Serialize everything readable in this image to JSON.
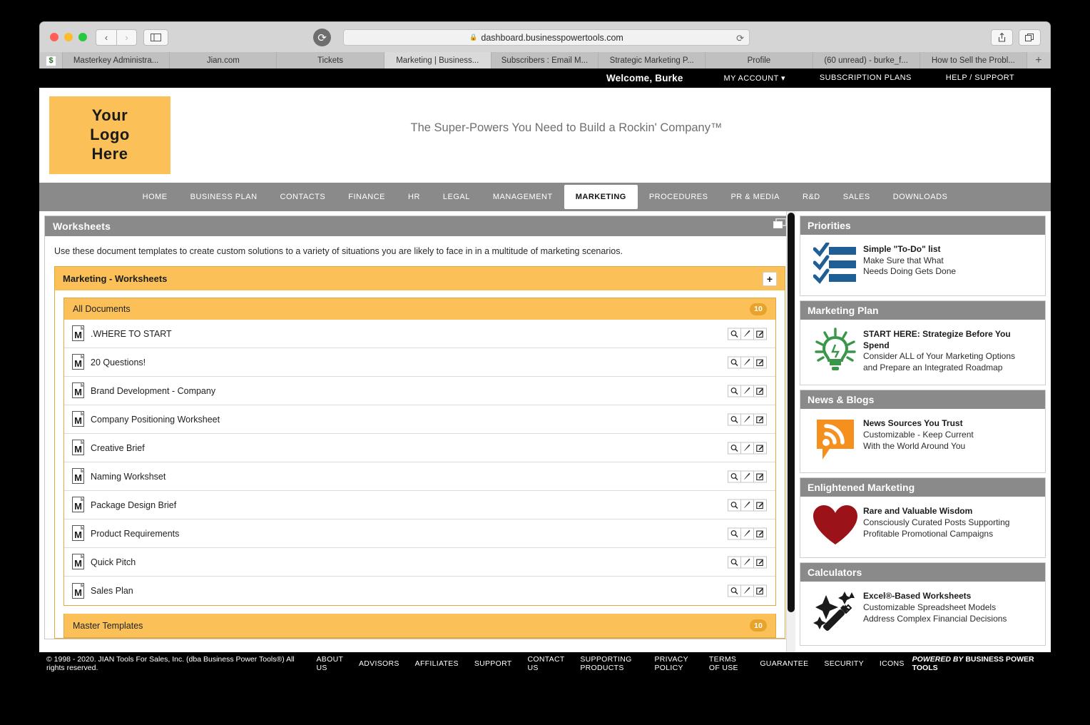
{
  "browser": {
    "url": "dashboard.businesspowertools.com",
    "lock_icon": "lock-icon",
    "back_label": "‹",
    "forward_label": "›",
    "sidebar_icon": "sidebar-icon",
    "reload_icon": "reload-icon",
    "share_icon": "share-icon",
    "tabs_overview_icon": "tabs-overview-icon",
    "new_tab_label": "+",
    "favicon_label": "$",
    "tabs": [
      {
        "label": "Masterkey Administra...",
        "active": false
      },
      {
        "label": "Jian.com",
        "active": false
      },
      {
        "label": "Tickets",
        "active": false
      },
      {
        "label": "Marketing | Business...",
        "active": true
      },
      {
        "label": "Subscribers : Email M...",
        "active": false
      },
      {
        "label": "Strategic Marketing P...",
        "active": false
      },
      {
        "label": "Profile",
        "active": false
      },
      {
        "label": "(60 unread) - burke_f...",
        "active": false
      },
      {
        "label": "How to Sell the Probl...",
        "active": false
      }
    ]
  },
  "topbar": {
    "welcome": "Welcome, Burke",
    "menu": [
      {
        "label": "MY ACCOUNT ▾"
      },
      {
        "label": "SUBSCRIPTION PLANS"
      },
      {
        "label": "HELP / SUPPORT"
      }
    ]
  },
  "header": {
    "logo_lines": [
      "Your",
      "Logo",
      "Here"
    ],
    "tagline": "The Super-Powers You Need to Build a Rockin' Company™"
  },
  "mainnav": [
    {
      "label": "HOME",
      "active": false
    },
    {
      "label": "BUSINESS PLAN",
      "active": false
    },
    {
      "label": "CONTACTS",
      "active": false
    },
    {
      "label": "FINANCE",
      "active": false
    },
    {
      "label": "HR",
      "active": false
    },
    {
      "label": "LEGAL",
      "active": false
    },
    {
      "label": "MANAGEMENT",
      "active": false
    },
    {
      "label": "MARKETING",
      "active": true
    },
    {
      "label": "PROCEDURES",
      "active": false
    },
    {
      "label": "PR & MEDIA",
      "active": false
    },
    {
      "label": "R&D",
      "active": false
    },
    {
      "label": "SALES",
      "active": false
    },
    {
      "label": "DOWNLOADS",
      "active": false
    }
  ],
  "worksheets": {
    "panel_title": "Worksheets",
    "panel_icon": "restore-window-icon",
    "intro": "Use these document templates to create custom solutions to a variety of situations you are likely to face in in a multitude of marketing scenarios.",
    "group_title": "Marketing - Worksheets",
    "add_label": "+",
    "all_documents_label": "All Documents",
    "all_documents_count": "10",
    "master_templates_label": "Master Templates",
    "master_templates_count": "10",
    "row_actions": [
      {
        "icon": "magnifier-icon",
        "name": "preview-button"
      },
      {
        "icon": "pencil-icon",
        "name": "edit-button"
      },
      {
        "icon": "edit-square-icon",
        "name": "edit-online-button"
      }
    ],
    "documents": [
      {
        "name": ".WHERE TO START",
        "icon": "word-doc-icon"
      },
      {
        "name": "20 Questions!",
        "icon": "word-doc-icon"
      },
      {
        "name": "Brand Development - Company",
        "icon": "word-doc-icon"
      },
      {
        "name": "Company Positioning Worksheet",
        "icon": "word-doc-icon"
      },
      {
        "name": "Creative Brief",
        "icon": "word-doc-icon"
      },
      {
        "name": "Naming Workshset",
        "icon": "word-doc-icon"
      },
      {
        "name": "Package Design Brief",
        "icon": "word-doc-icon"
      },
      {
        "name": "Product Requirements",
        "icon": "word-doc-icon"
      },
      {
        "name": "Quick Pitch",
        "icon": "word-doc-icon"
      },
      {
        "name": "Sales Plan",
        "icon": "word-doc-icon"
      }
    ]
  },
  "sidebar_cards": [
    {
      "title": "Priorities",
      "icon": "checklist-icon",
      "line1": "Simple \"To-Do\" list",
      "line2": "Make Sure that What",
      "line3": "Needs Doing Gets Done"
    },
    {
      "title": "Marketing Plan",
      "icon": "lightbulb-icon",
      "line1": "START HERE: Strategize Before You Spend",
      "line2": "Consider ALL of Your Marketing Options",
      "line3": "and Prepare an Integrated Roadmap"
    },
    {
      "title": "News & Blogs",
      "icon": "rss-icon",
      "line1": "News Sources You Trust",
      "line2": "Customizable - Keep Current",
      "line3": "With the World Around You"
    },
    {
      "title": "Enlightened Marketing",
      "icon": "heart-icon",
      "line1": "Rare and Valuable Wisdom",
      "line2": "Consciously Curated Posts Supporting",
      "line3": "Profitable Promotional Campaigns"
    },
    {
      "title": "Calculators",
      "icon": "magic-wand-icon",
      "line1": "Excel®-Based Worksheets",
      "line2": "Customizable Spreadsheet Models",
      "line3": "Address Complex Financial Decisions"
    }
  ],
  "footer": {
    "copyright": "© 1998 - 2020. JIAN Tools For Sales, Inc. (dba Business Power Tools®) All rights reserved.",
    "links": [
      "ABOUT US",
      "ADVISORS",
      "AFFILIATES",
      "SUPPORT",
      "CONTACT US",
      "SUPPORTING PRODUCTS",
      "PRIVACY POLICY",
      "TERMS OF USE",
      "GUARANTEE",
      "SECURITY",
      "ICONS"
    ],
    "powered_italic": "POWERED BY",
    "powered_rest": " BUSINESS POWER TOOLS"
  },
  "colors": {
    "accent_yellow": "#fbc158",
    "panel_gray": "#8a8a8a",
    "badge_orange": "#e8a32c",
    "green": "#3a9648",
    "orange": "#f5901e",
    "dark_red": "#9c1219",
    "blue": "#1f5f96"
  }
}
